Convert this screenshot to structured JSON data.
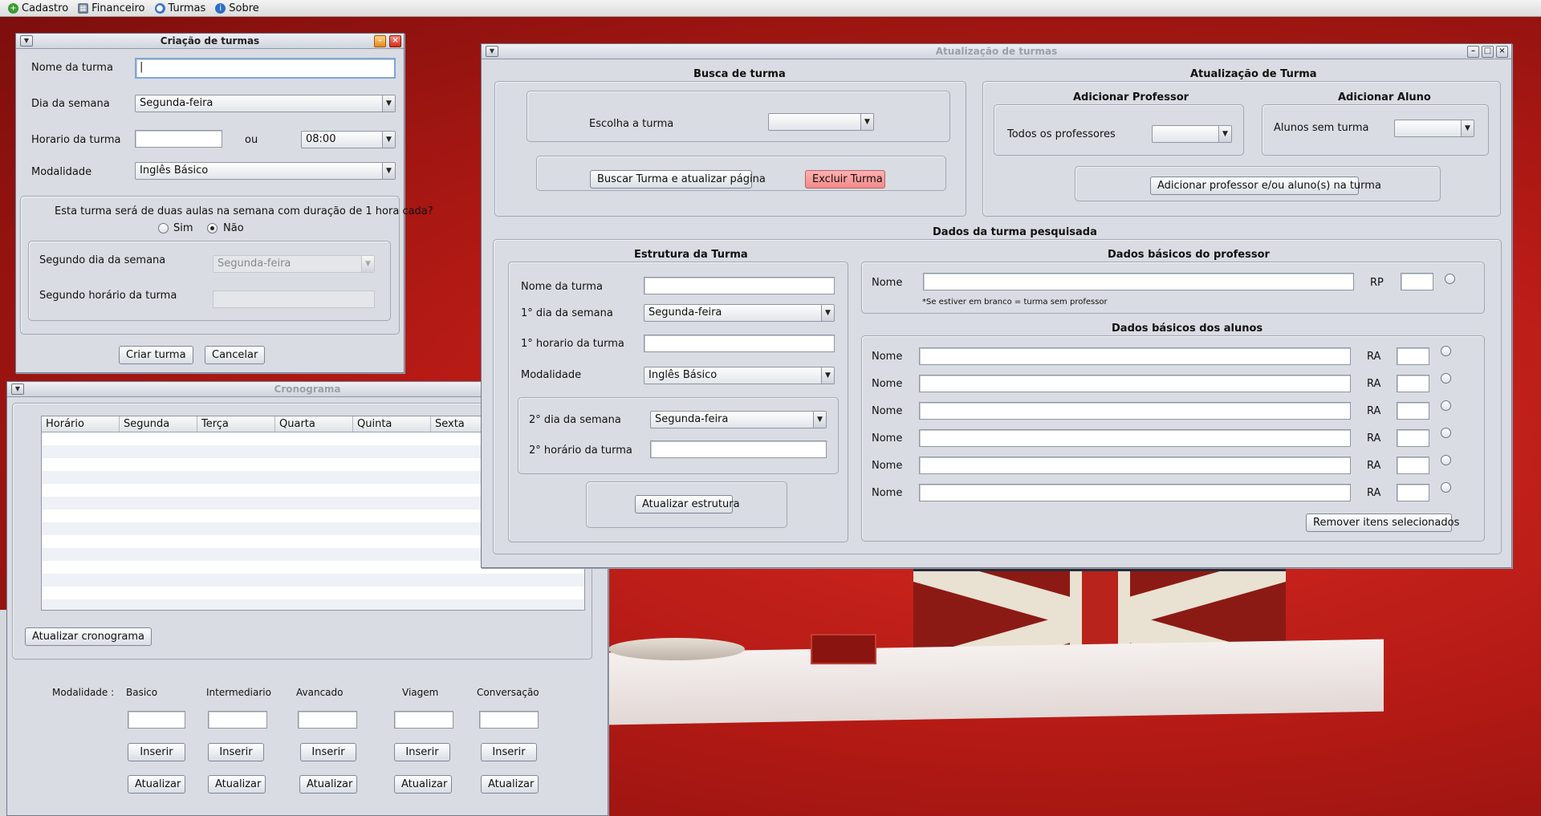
{
  "menubar": {
    "items": [
      {
        "label": "Cadastro",
        "icon": "plus-circle-icon",
        "color": "#3a9c2f"
      },
      {
        "label": "Financeiro",
        "icon": "calculator-icon",
        "color": "#6c7a90"
      },
      {
        "label": "Turmas",
        "icon": "users-icon",
        "color": "#3b76c4"
      },
      {
        "label": "Sobre",
        "icon": "info-icon",
        "color": "#2f6fc4"
      }
    ]
  },
  "criacao": {
    "title": "Criação de turmas",
    "nome_label": "Nome da turma",
    "nome_value": "",
    "dia_label": "Dia da semana",
    "dia_value": "Segunda-feira",
    "horario_label": "Horario da turma",
    "horario_value": "",
    "ou_label": "ou",
    "horario_combo": "08:00",
    "modalidade_label": "Modalidade",
    "modalidade_value": "Inglês Básico",
    "pergunta": "Esta turma será de duas aulas na semana com duração de 1 hora cada?",
    "sim_label": "Sim",
    "nao_label": "Não",
    "selected": "Não",
    "segundo_dia_label": "Segundo dia da semana",
    "segundo_dia_value": "Segunda-feira",
    "segundo_horario_label": "Segundo horário da turma",
    "criar_btn": "Criar turma",
    "cancelar_btn": "Cancelar"
  },
  "cronograma": {
    "title": "Cronograma",
    "columns": [
      "Horário",
      "Segunda",
      "Terça",
      "Quarta",
      "Quinta",
      "Sexta"
    ],
    "atualizar_btn": "Atualizar cronograma",
    "modalidade_label": "Modalidade :",
    "modalidades": [
      "Basico",
      "Intermediario",
      "Avancado",
      "Viagem",
      "Conversação"
    ],
    "inserir_btn": "Inserir",
    "atualizar_mod_btn": "Atualizar"
  },
  "atualizacao": {
    "title": "Atualização de turmas",
    "busca_title": "Busca de turma",
    "escolha_label": "Escolha a turma",
    "escolha_value": "",
    "buscar_btn": "Buscar Turma e atualizar página",
    "excluir_btn": "Excluir Turma",
    "atual_title": "Atualização de Turma",
    "add_prof_title": "Adicionar Professor",
    "todos_prof_label": "Todos os professores",
    "add_aluno_title": "Adicionar Aluno",
    "alunos_sem_label": "Alunos sem turma",
    "add_btn": "Adicionar professor e/ou aluno(s) na turma",
    "dados_title": "Dados da turma pesquisada",
    "estrutura_title": "Estrutura da Turma",
    "nome_label": "Nome da turma",
    "dia1_label": "1° dia da semana",
    "dia1_value": "Segunda-feira",
    "horario1_label": "1° horario da turma",
    "modalidade_label": "Modalidade",
    "modalidade_value": "Inglês Básico",
    "dia2_label": "2° dia da semana",
    "dia2_value": "Segunda-feira",
    "horario2_label": "2°  horário da turma",
    "atualizar_estrutura_btn": "Atualizar estrutura",
    "prof_title": "Dados básicos do professor",
    "prof_nome_label": "Nome",
    "rp_label": "RP",
    "prof_note": "*Se estiver em branco = turma sem professor",
    "alunos_title": "Dados básicos dos alunos",
    "alunos": [
      {
        "nome_label": "Nome",
        "ra_label": "RA"
      },
      {
        "nome_label": "Nome",
        "ra_label": "RA"
      },
      {
        "nome_label": "Nome",
        "ra_label": "RA"
      },
      {
        "nome_label": "Nome",
        "ra_label": "RA"
      },
      {
        "nome_label": "Nome",
        "ra_label": "RA"
      },
      {
        "nome_label": "Nome",
        "ra_label": "RA"
      }
    ],
    "remover_btn": "Remover itens selecionados"
  }
}
